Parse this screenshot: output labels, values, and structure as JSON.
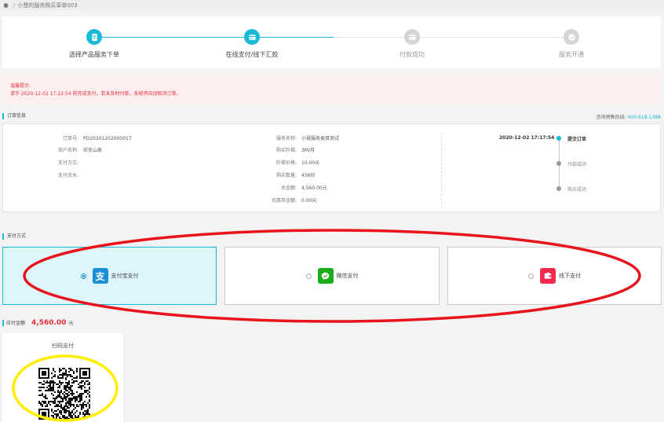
{
  "breadcrumb": {
    "separator": "/",
    "current": "小慧的服务购买草单003"
  },
  "steps": [
    {
      "label": "选择产品服务下单",
      "state": "done",
      "icon": "document-icon"
    },
    {
      "label": "在线支付/线下汇款",
      "state": "active",
      "icon": "payment-card-icon"
    },
    {
      "label": "付款成功",
      "state": "pending",
      "icon": "payment-card-icon"
    },
    {
      "label": "服务开通",
      "state": "pending",
      "icon": "check-icon"
    }
  ],
  "alert": {
    "title": "温馨提示:",
    "message": "请于 2020-12-02 17:22:54 前完成支付，若未及时付款，系统将自动取消订单。"
  },
  "order_section": {
    "title": "订单信息",
    "hotline_label": "咨询销售热线:",
    "hotline": "400-618-1388"
  },
  "order_left": [
    {
      "k": "订单号:",
      "v": "PD20201202000017"
    },
    {
      "k": "商户名称:",
      "v": "农夫山泉"
    },
    {
      "k": "支付方式:",
      "v": ""
    },
    {
      "k": "支付流水:",
      "v": ""
    }
  ],
  "order_mid": [
    {
      "k": "服务名称:",
      "v": "小慧服务类目测试"
    },
    {
      "k": "购买阶梯:",
      "v": "3M/月"
    },
    {
      "k": "阶梯价格:",
      "v": "10.00元"
    },
    {
      "k": "购买数量:",
      "v": "456份"
    },
    {
      "k": "总金额:",
      "v": "4,560.00元"
    },
    {
      "k": "优惠券金额:",
      "v": "0.00元"
    }
  ],
  "timeline": {
    "time": "2020-12-02 17:17:54",
    "items": [
      {
        "text": "提交订单",
        "state": "done"
      },
      {
        "text": "付款成功",
        "state": "pending"
      },
      {
        "text": "购买成功",
        "state": "pending"
      }
    ]
  },
  "payment_section": {
    "title": "支付方式"
  },
  "payment_methods": [
    {
      "label": "支付宝支付",
      "selected": true,
      "icon": "alipay-icon",
      "color": "#1a8fd8",
      "glyph": "支"
    },
    {
      "label": "微信支付",
      "selected": false,
      "icon": "wechat-icon",
      "color": "#1aad19",
      "glyph": ""
    },
    {
      "label": "线下支付",
      "selected": false,
      "icon": "wallet-icon",
      "color": "#f0294f",
      "glyph": ""
    }
  ],
  "amount": {
    "label": "应付金额",
    "value": "4,560.00",
    "unit": "元"
  },
  "qr": {
    "title": "扫码支付",
    "icon": "qr-code-icon"
  },
  "colors": {
    "accent": "#1ab9d8",
    "danger": "#e0313a",
    "annotation_red": "#e8141c",
    "annotation_yellow": "#ffee00"
  }
}
